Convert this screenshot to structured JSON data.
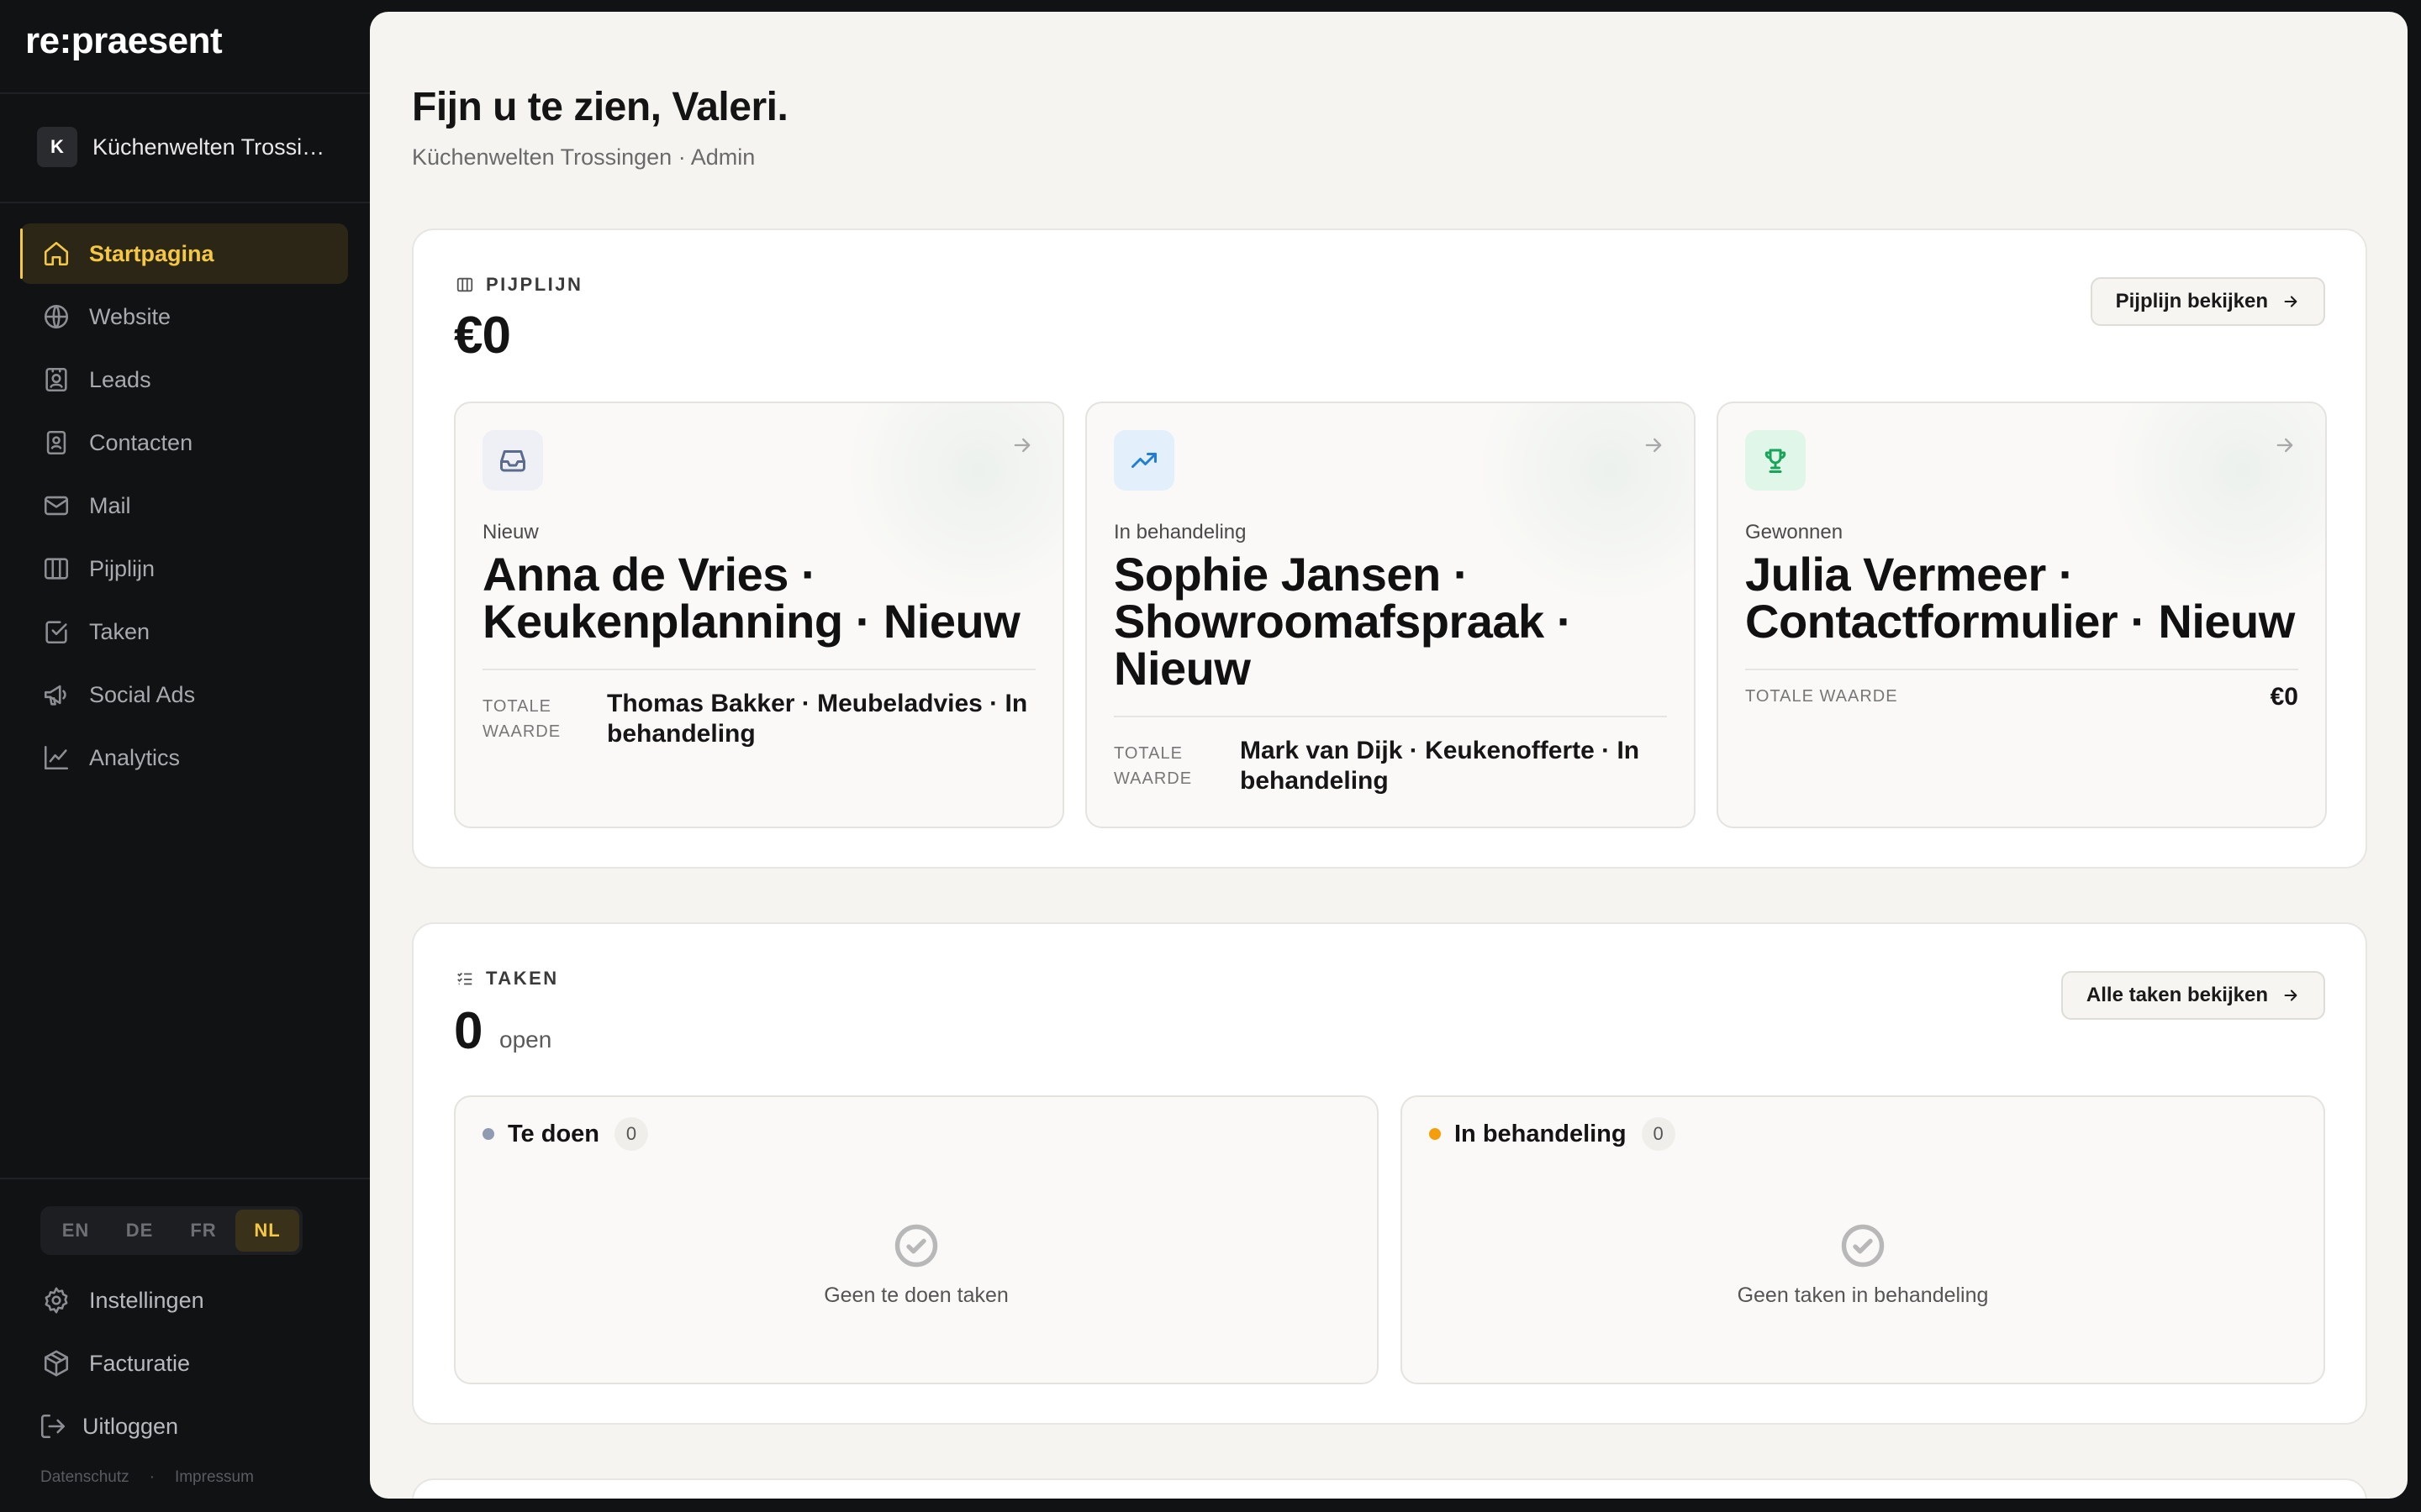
{
  "app": {
    "logo": "re:praesent"
  },
  "org": {
    "initial": "K",
    "name": "Küchenwelten Trossingen"
  },
  "nav": [
    {
      "label": "Startpagina",
      "icon": "home-icon",
      "active": true
    },
    {
      "label": "Website",
      "icon": "globe-icon"
    },
    {
      "label": "Leads",
      "icon": "contact-badge-icon"
    },
    {
      "label": "Contacten",
      "icon": "address-book-icon"
    },
    {
      "label": "Mail",
      "icon": "mail-icon"
    },
    {
      "label": "Pijplijn",
      "icon": "kanban-columns-icon"
    },
    {
      "label": "Taken",
      "icon": "checkbox-icon"
    },
    {
      "label": "Social Ads",
      "icon": "megaphone-icon"
    },
    {
      "label": "Analytics",
      "icon": "line-chart-icon"
    }
  ],
  "languages": {
    "options": [
      "EN",
      "DE",
      "FR",
      "NL"
    ],
    "selected": "NL"
  },
  "bottom_nav": [
    {
      "label": "Instellingen",
      "icon": "gear-icon"
    },
    {
      "label": "Facturatie",
      "icon": "package-icon"
    },
    {
      "label": "Uitloggen",
      "icon": "logout-icon"
    }
  ],
  "footer": {
    "privacy": "Datenschutz",
    "separator": "·",
    "imprint": "Impressum"
  },
  "header": {
    "greeting": "Fijn u te zien, Valeri.",
    "subline": "Küchenwelten Trossingen · Admin"
  },
  "pipeline": {
    "label": "PIJPLIJN",
    "total": "€0",
    "button": "Pijplijn bekijken",
    "deals": [
      {
        "stage": "Nieuw",
        "title": "Anna de Vries · Keukenplanning · Nieuw",
        "value_label": "TOTALE WAARDE",
        "value": "Thomas Bakker · Meubeladvies · In behandeling",
        "icon": "inbox-icon",
        "accent": "#5b6b8c"
      },
      {
        "stage": "In behandeling",
        "title": "Sophie Jansen · Showroomafspraak · Nieuw",
        "value_label": "TOTALE WAARDE",
        "value": "Mark van Dijk · Keukenofferte · In behandeling",
        "icon": "trending-up-icon",
        "accent": "#1f7fd6"
      },
      {
        "stage": "Gewonnen",
        "title": "Julia Vermeer · Contactformulier · Nieuw",
        "value_label": "TOTALE WAARDE",
        "value": "€0",
        "icon": "trophy-icon",
        "accent": "#17a55a"
      }
    ]
  },
  "tasks": {
    "label": "TAKEN",
    "count": "0",
    "count_suffix": "open",
    "button": "Alle taken bekijken",
    "columns": [
      {
        "name": "Te doen",
        "count": "0",
        "dot_color": "#8f9bb0",
        "empty": "Geen te doen taken"
      },
      {
        "name": "In behandeling",
        "count": "0",
        "dot_color": "#f59e0b",
        "empty": "Geen taken in behandeling"
      }
    ]
  }
}
